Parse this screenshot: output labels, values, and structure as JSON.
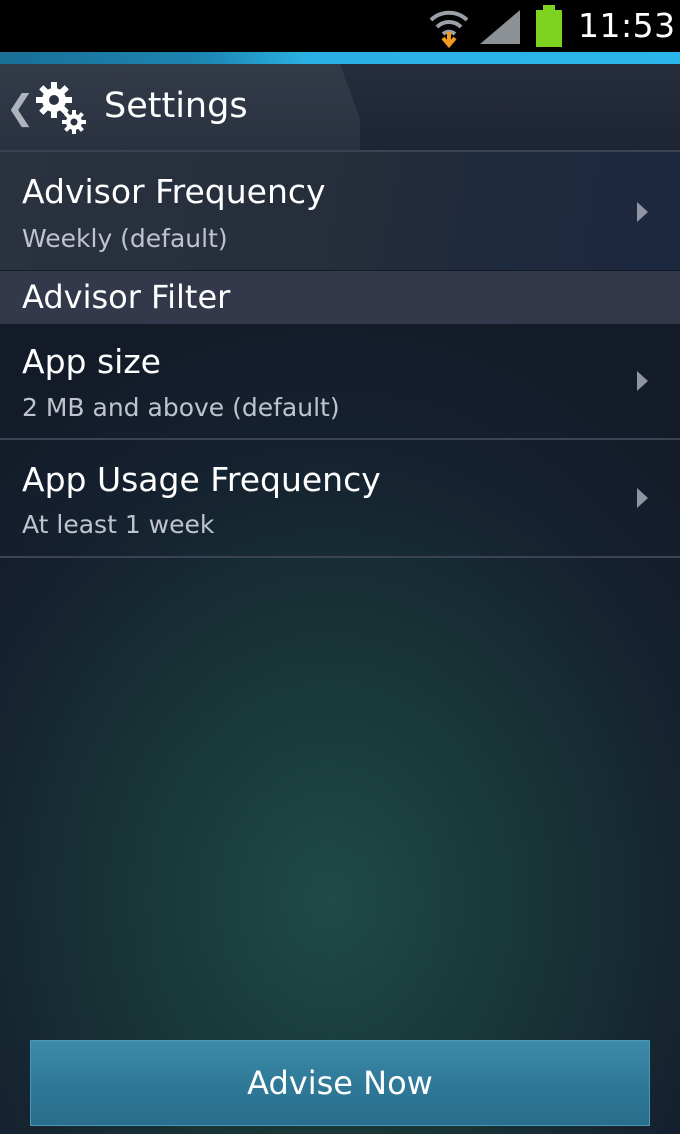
{
  "status_bar": {
    "time": "11:53",
    "icons": [
      "wifi-icon",
      "signal-icon",
      "battery-icon"
    ],
    "battery_color": "#7ed321"
  },
  "action_bar": {
    "title": "Settings",
    "back_icon": "chevron-left-icon",
    "app_icon": "gears-icon"
  },
  "settings": {
    "items": [
      {
        "title": "Advisor Frequency",
        "summary": "Weekly (default)"
      },
      {
        "title": "App size",
        "summary": "2 MB and above (default)"
      },
      {
        "title": "App Usage Frequency",
        "summary": "At least 1 week"
      }
    ],
    "section_header": "Advisor Filter"
  },
  "footer": {
    "advise_button_label": "Advise Now"
  },
  "colors": {
    "accent": "#2ab0e2",
    "button": "#2e7897",
    "background": "#15202f"
  }
}
